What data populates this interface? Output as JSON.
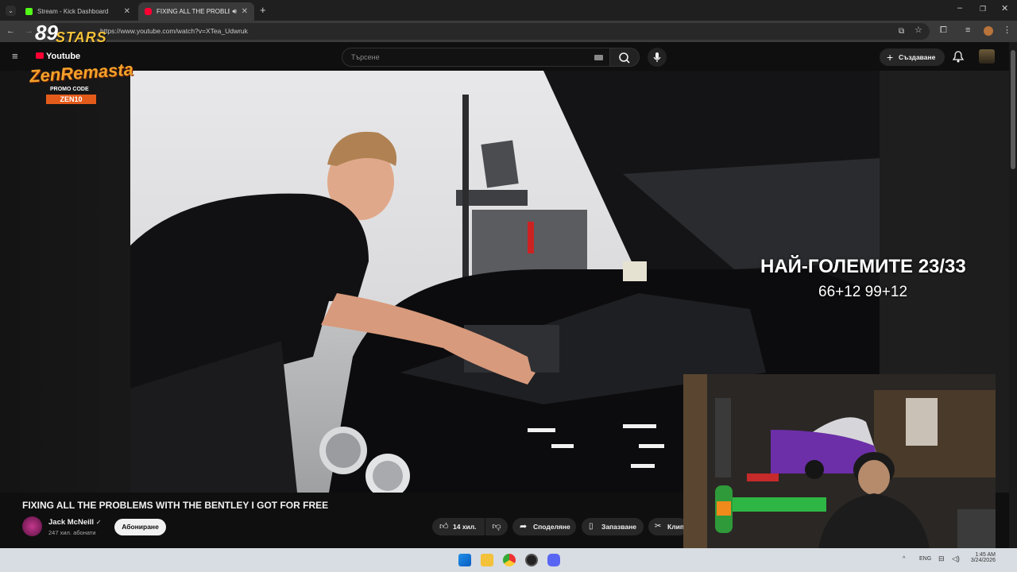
{
  "browser": {
    "tabs": [
      {
        "title": "Stream - Kick Dashboard",
        "active": false,
        "favicon_color": "#53fc18"
      },
      {
        "title": "FIXING ALL THE PROBLEMS",
        "active": true,
        "favicon_color": "#ff0033"
      }
    ],
    "url": "https://www.youtube.com/watch?v=XTea_Udwruk"
  },
  "youtube": {
    "search_placeholder": "Търсене",
    "create_label": "Създаване"
  },
  "stream_logo": {
    "line1": "89",
    "line2": "STARS",
    "line3": "Youtube",
    "line4": "ZenRemasta",
    "promo": "PROMO CODE",
    "code": "ZEN10"
  },
  "overlay": {
    "title": "НАЙ-ГОЛЕМИТЕ 23/33",
    "numbers": "66+12 99+12"
  },
  "video": {
    "title": "FIXING ALL THE PROBLEMS WITH THE BENTLEY I GOT FOR FREE",
    "channel": "Jack McNeill",
    "subscribers": "247 хил. абонати",
    "subscribe_label": "Абониране",
    "likes": "14 хил.",
    "share_label": "Споделяне",
    "save_label": "Запазване",
    "clip_label": "Клип"
  },
  "taskbar": {
    "language": "ENG",
    "time": "1:45 AM",
    "date": "3/24/2026"
  },
  "colors": {
    "youtube_red": "#ff0033",
    "kick_green": "#53fc18",
    "background": "#0f0f0f"
  }
}
